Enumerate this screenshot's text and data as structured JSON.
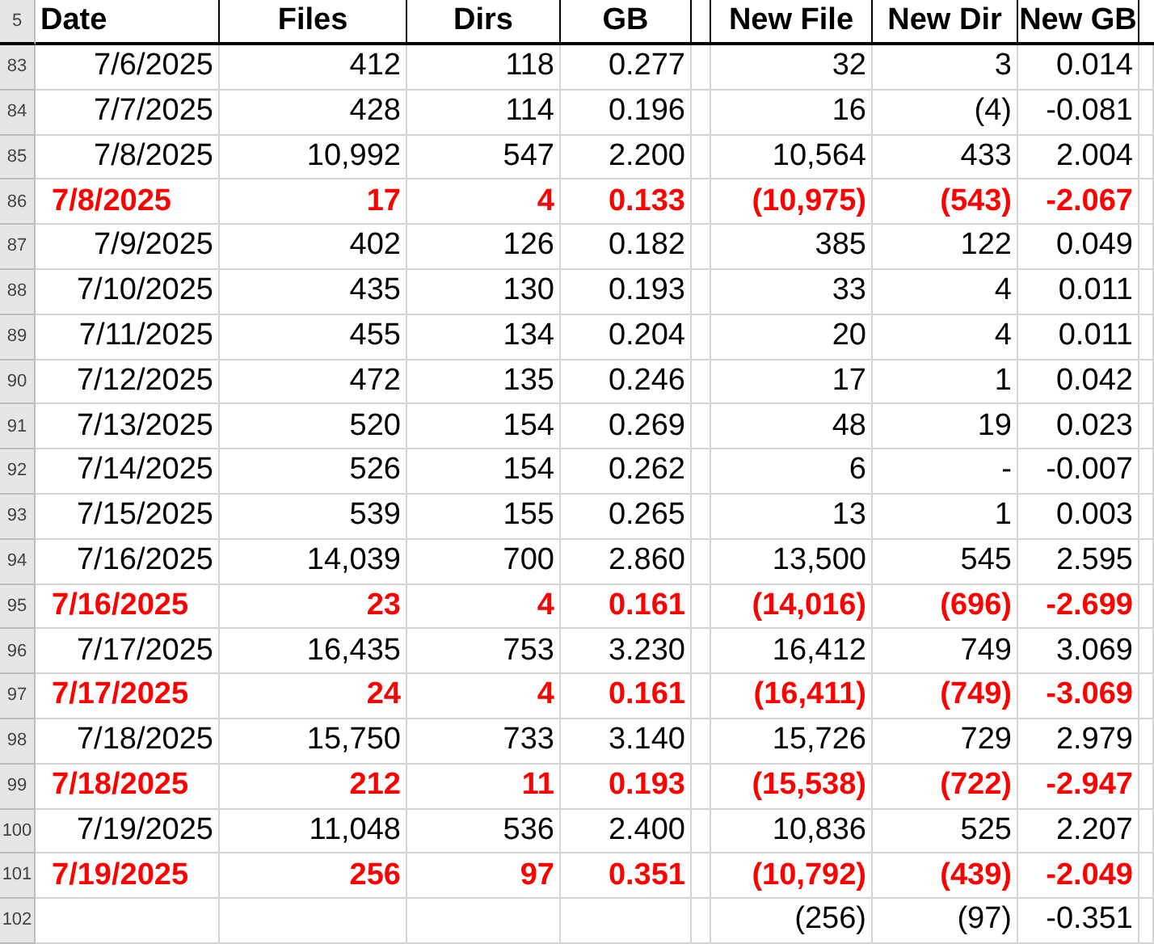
{
  "header_row": {
    "row_number": "5",
    "columns": [
      "Date",
      "Files",
      "Dirs",
      "GB",
      null,
      "New File",
      "New Dir",
      "New GB",
      null
    ]
  },
  "rows": [
    {
      "row_number": "83",
      "highlight": false,
      "cells": [
        "7/6/2025",
        "412",
        "118",
        "0.277",
        null,
        "32",
        "3",
        "0.014",
        null
      ]
    },
    {
      "row_number": "84",
      "highlight": false,
      "cells": [
        "7/7/2025",
        "428",
        "114",
        "0.196",
        null,
        "16",
        "(4)",
        "-0.081",
        null
      ]
    },
    {
      "row_number": "85",
      "highlight": false,
      "cells": [
        "7/8/2025",
        "10,992",
        "547",
        "2.200",
        null,
        "10,564",
        "433",
        "2.004",
        null
      ]
    },
    {
      "row_number": "86",
      "highlight": true,
      "cells": [
        "7/8/2025",
        "17",
        "4",
        "0.133",
        null,
        "(10,975)",
        "(543)",
        "-2.067",
        null
      ]
    },
    {
      "row_number": "87",
      "highlight": false,
      "cells": [
        "7/9/2025",
        "402",
        "126",
        "0.182",
        null,
        "385",
        "122",
        "0.049",
        null
      ]
    },
    {
      "row_number": "88",
      "highlight": false,
      "cells": [
        "7/10/2025",
        "435",
        "130",
        "0.193",
        null,
        "33",
        "4",
        "0.011",
        null
      ]
    },
    {
      "row_number": "89",
      "highlight": false,
      "cells": [
        "7/11/2025",
        "455",
        "134",
        "0.204",
        null,
        "20",
        "4",
        "0.011",
        null
      ]
    },
    {
      "row_number": "90",
      "highlight": false,
      "cells": [
        "7/12/2025",
        "472",
        "135",
        "0.246",
        null,
        "17",
        "1",
        "0.042",
        null
      ]
    },
    {
      "row_number": "91",
      "highlight": false,
      "cells": [
        "7/13/2025",
        "520",
        "154",
        "0.269",
        null,
        "48",
        "19",
        "0.023",
        null
      ]
    },
    {
      "row_number": "92",
      "highlight": false,
      "cells": [
        "7/14/2025",
        "526",
        "154",
        "0.262",
        null,
        "6",
        "-",
        "-0.007",
        null
      ]
    },
    {
      "row_number": "93",
      "highlight": false,
      "cells": [
        "7/15/2025",
        "539",
        "155",
        "0.265",
        null,
        "13",
        "1",
        "0.003",
        null
      ]
    },
    {
      "row_number": "94",
      "highlight": false,
      "cells": [
        "7/16/2025",
        "14,039",
        "700",
        "2.860",
        null,
        "13,500",
        "545",
        "2.595",
        null
      ]
    },
    {
      "row_number": "95",
      "highlight": true,
      "cells": [
        "7/16/2025",
        "23",
        "4",
        "0.161",
        null,
        "(14,016)",
        "(696)",
        "-2.699",
        null
      ]
    },
    {
      "row_number": "96",
      "highlight": false,
      "cells": [
        "7/17/2025",
        "16,435",
        "753",
        "3.230",
        null,
        "16,412",
        "749",
        "3.069",
        null
      ]
    },
    {
      "row_number": "97",
      "highlight": true,
      "cells": [
        "7/17/2025",
        "24",
        "4",
        "0.161",
        null,
        "(16,411)",
        "(749)",
        "-3.069",
        null
      ]
    },
    {
      "row_number": "98",
      "highlight": false,
      "cells": [
        "7/18/2025",
        "15,750",
        "733",
        "3.140",
        null,
        "15,726",
        "729",
        "2.979",
        null
      ]
    },
    {
      "row_number": "99",
      "highlight": true,
      "cells": [
        "7/18/2025",
        "212",
        "11",
        "0.193",
        null,
        "(15,538)",
        "(722)",
        "-2.947",
        null
      ]
    },
    {
      "row_number": "100",
      "highlight": false,
      "cells": [
        "7/19/2025",
        "11,048",
        "536",
        "2.400",
        null,
        "10,836",
        "525",
        "2.207",
        null
      ]
    },
    {
      "row_number": "101",
      "highlight": true,
      "cells": [
        "7/19/2025",
        "256",
        "97",
        "0.351",
        null,
        "(10,792)",
        "(439)",
        "-2.049",
        null
      ]
    },
    {
      "row_number": "102",
      "highlight": false,
      "cells": [
        null,
        null,
        null,
        null,
        null,
        "(256)",
        "(97)",
        "-0.351",
        null
      ]
    }
  ]
}
